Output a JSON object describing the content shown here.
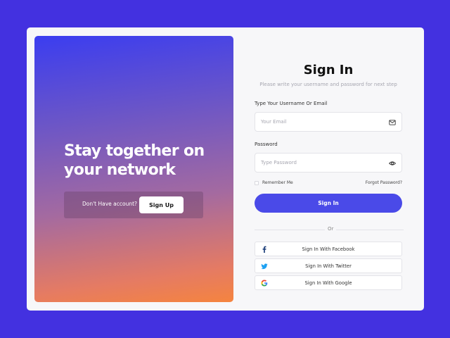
{
  "colors": {
    "background": "#4331e0",
    "card": "#f7f7f9",
    "accent": "#4a4ae8",
    "gradient_start": "#3b3df0",
    "gradient_end": "#f5843f"
  },
  "hero": {
    "title_line1": "Stay together on",
    "title_line2": "your network",
    "signup_prompt": "Don't Have account?",
    "signup_button": "Sign Up"
  },
  "form": {
    "title": "Sign In",
    "subtitle": "Please write your username and password for next step",
    "username": {
      "label": "Type Your Username Or Email",
      "placeholder": "Your Email",
      "value": "",
      "icon": "mail-icon"
    },
    "password": {
      "label": "Password",
      "placeholder": "Type Password",
      "value": "",
      "icon": "eye-icon"
    },
    "remember_me": "Remember Me",
    "forgot_password": "Forgot Password?",
    "signin_button": "Sign In",
    "divider_text": "Or"
  },
  "social": [
    {
      "label": "Sign In With Facebook",
      "icon": "facebook-icon"
    },
    {
      "label": "Sign In With Twitter",
      "icon": "twitter-icon"
    },
    {
      "label": "Sign In With Google",
      "icon": "google-icon"
    }
  ]
}
